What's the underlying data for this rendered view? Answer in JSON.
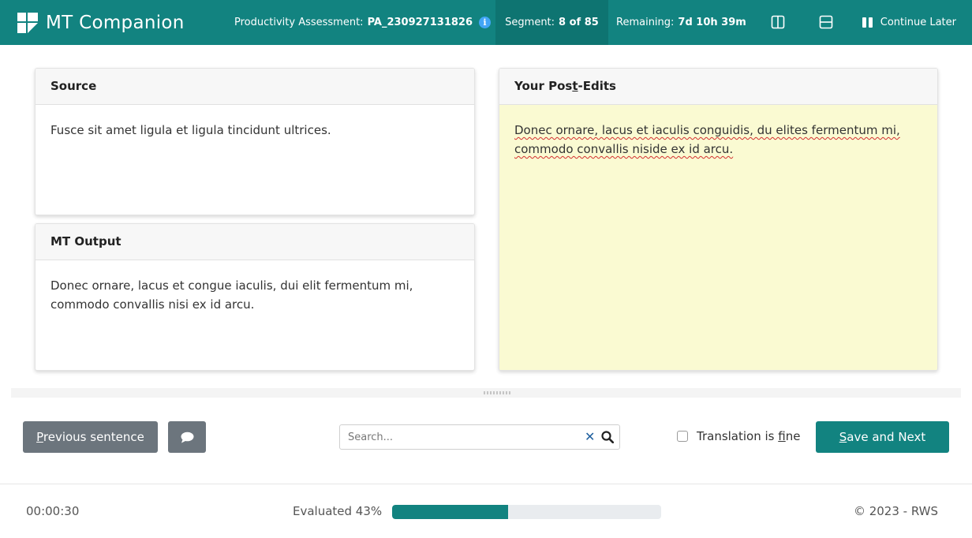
{
  "app": {
    "title": "MT Companion"
  },
  "header": {
    "assessment_label": "Productivity Assessment:",
    "assessment_id": "PA_230927131826",
    "segment_label": "Segment:",
    "segment_value": "8 of 85",
    "remaining_label": "Remaining:",
    "remaining_value": "7d 10h 39m",
    "continue_label": "Continue Later",
    "icons": [
      "brand-logo-icon",
      "info-icon",
      "columns-layout-icon",
      "rows-layout-icon",
      "pause-icon"
    ]
  },
  "source": {
    "header": "Source",
    "text": "Fusce sit amet ligula et ligula tincidunt ultrices."
  },
  "mt_output": {
    "header": "MT Output",
    "text": "Donec ornare, lacus et congue iaculis, dui elit fermentum mi, commodo convallis nisi ex id arcu."
  },
  "post_edit": {
    "header_pre": "Your Pos",
    "header_accel": "t",
    "header_post": "-Edits",
    "text": "Donec ornare, lacus et iaculis conguidis, du elites fermentum mi, commodo convallis niside ex id arcu.",
    "background": "#fafad2"
  },
  "actions": {
    "prev_accel": "P",
    "prev_rest": "revious sentence",
    "search_placeholder": "Search...",
    "fine_pre": "Translation is ",
    "fine_accel": "f",
    "fine_post": "ine",
    "fine_checked": false,
    "save_accel": "S",
    "save_rest": "ave and Next"
  },
  "footer": {
    "timer": "00:00:30",
    "evaluated_label": "Evaluated 43%",
    "progress_percent": 43,
    "copyright": "© 2023 - RWS"
  },
  "colors": {
    "accent": "#128380",
    "secondary_button": "#6c757d",
    "info": "#42a5f5"
  }
}
